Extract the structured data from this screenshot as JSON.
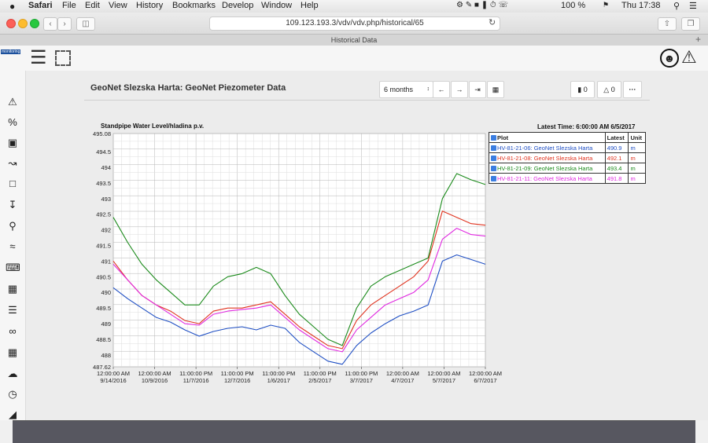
{
  "menubar": {
    "apple": "",
    "items": [
      "Safari",
      "File",
      "Edit",
      "View",
      "History",
      "Bookmarks",
      "Develop",
      "Window",
      "Help"
    ],
    "battery": "100 %",
    "clock": "Thu 17:38"
  },
  "browser": {
    "url": "109.123.193.3/vdv/vdv.php/historical/65",
    "tab_title": "Historical Data"
  },
  "app": {
    "logo": "monitoring",
    "page_title": "GeoNet Slezska Harta: GeoNet Piezometer Data",
    "period": "6 months",
    "comments_count": "0",
    "alerts_count": "0",
    "more": "···"
  },
  "sidebar": {
    "icons": [
      "warning-icon",
      "percent-icon",
      "monitor-icon",
      "chart-icon",
      "folder-icon",
      "download-icon",
      "map-pin-icon",
      "wave-icon",
      "keyboard-icon",
      "calendar-icon",
      "list-icon",
      "binoculars-icon",
      "layout-icon",
      "cloud-download-icon",
      "clock-icon",
      "tag-icon"
    ]
  },
  "chart_data": {
    "type": "line",
    "title": "Standpipe Water Level/hladina p.v.",
    "latest_time": "Latest Time: 6:00:00 AM 6/5/2017",
    "ylim": [
      487.62,
      495.08
    ],
    "yticks": [
      "495.08",
      "494.5",
      "494",
      "493.5",
      "493",
      "492.5",
      "492",
      "491.5",
      "491",
      "490.5",
      "490",
      "489.5",
      "489",
      "488.5",
      "488",
      "487.62"
    ],
    "xticks": [
      {
        "time": "12:00:00 AM",
        "date": "9/14/2016"
      },
      {
        "time": "12:00:00 AM",
        "date": "10/9/2016"
      },
      {
        "time": "11:00:00 PM",
        "date": "11/7/2016"
      },
      {
        "time": "11:00:00 PM",
        "date": "12/7/2016"
      },
      {
        "time": "11:00:00 PM",
        "date": "1/6/2017"
      },
      {
        "time": "11:00:00 PM",
        "date": "2/5/2017"
      },
      {
        "time": "11:00:00 PM",
        "date": "3/7/2017"
      },
      {
        "time": "12:00:00 AM",
        "date": "4/7/2017"
      },
      {
        "time": "12:00:00 AM",
        "date": "5/7/2017"
      },
      {
        "time": "12:00:00 AM",
        "date": "6/7/2017"
      }
    ],
    "grid": true,
    "legend_headers": {
      "plot": "Plot",
      "latest": "Latest",
      "unit": "Unit"
    },
    "series": [
      {
        "name": "HV-81-21-06: GeoNet Slezska Harta",
        "latest": "490.9",
        "unit": "m",
        "color": "#1f4fc4",
        "values": [
          490.15,
          489.8,
          489.5,
          489.2,
          489.05,
          488.8,
          488.6,
          488.75,
          488.85,
          488.9,
          488.8,
          488.95,
          488.85,
          488.4,
          488.1,
          487.8,
          487.7,
          488.3,
          488.7,
          489.0,
          489.25,
          489.4,
          489.6,
          491.0,
          491.2,
          491.05,
          490.9
        ]
      },
      {
        "name": "HV-81-21-08: GeoNet Slezska Harta",
        "latest": "492.1",
        "unit": "m",
        "color": "#e0331f",
        "values": [
          491.0,
          490.4,
          489.9,
          489.6,
          489.4,
          489.1,
          489.0,
          489.4,
          489.5,
          489.5,
          489.6,
          489.7,
          489.3,
          488.9,
          488.6,
          488.3,
          488.2,
          489.1,
          489.6,
          489.9,
          490.2,
          490.5,
          491.0,
          492.6,
          492.4,
          492.2,
          492.15
        ]
      },
      {
        "name": "HV-81-21-09: GeoNet Slezska Harta",
        "latest": "493.4",
        "unit": "m",
        "color": "#1a8a1a",
        "values": [
          492.4,
          491.6,
          490.9,
          490.4,
          490.0,
          489.6,
          489.6,
          490.2,
          490.5,
          490.6,
          490.8,
          490.6,
          489.9,
          489.3,
          488.9,
          488.5,
          488.3,
          489.5,
          490.2,
          490.5,
          490.7,
          490.9,
          491.1,
          493.0,
          493.8,
          493.6,
          493.45
        ]
      },
      {
        "name": "HV-81-21-11: GeoNet Slezska Harta",
        "latest": "491.8",
        "unit": "m",
        "color": "#e028e0",
        "values": [
          490.9,
          490.4,
          489.9,
          489.6,
          489.3,
          489.0,
          488.95,
          489.3,
          489.4,
          489.45,
          489.5,
          489.6,
          489.2,
          488.8,
          488.5,
          488.2,
          488.1,
          488.8,
          489.2,
          489.6,
          489.8,
          490.0,
          490.4,
          491.7,
          492.05,
          491.85,
          491.8
        ]
      }
    ]
  }
}
